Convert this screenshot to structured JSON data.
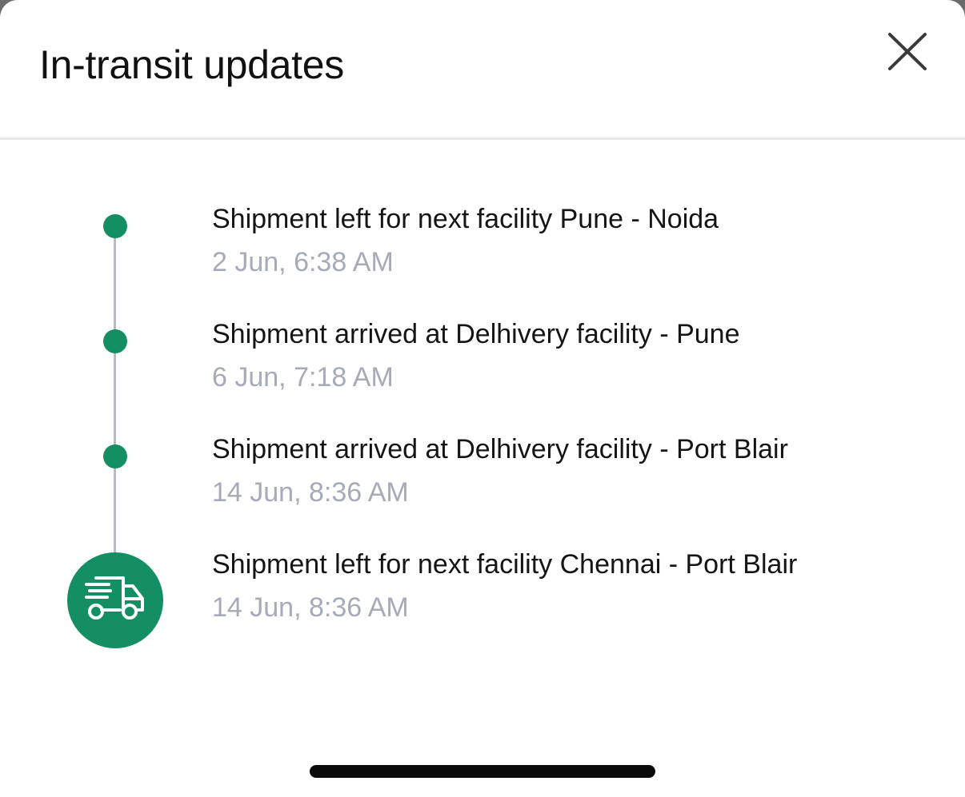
{
  "header": {
    "title": "In-transit updates",
    "close_icon": "close-icon"
  },
  "colors": {
    "accent": "#138f63",
    "line": "#b8b8c6",
    "time_text": "#a7aab8"
  },
  "events": [
    {
      "title": "Shipment left for next facility Pune - Noida",
      "time": "2 Jun, 6:38 AM"
    },
    {
      "title": "Shipment arrived at Delhivery facility - Pune",
      "time": "6 Jun, 7:18 AM"
    },
    {
      "title": "Shipment arrived at Delhivery facility - Port Blair",
      "time": "14 Jun, 8:36 AM"
    },
    {
      "title": "Shipment left for next facility Chennai - Port Blair",
      "time": "14 Jun, 8:36 AM",
      "icon": "delivery-truck-icon"
    }
  ]
}
